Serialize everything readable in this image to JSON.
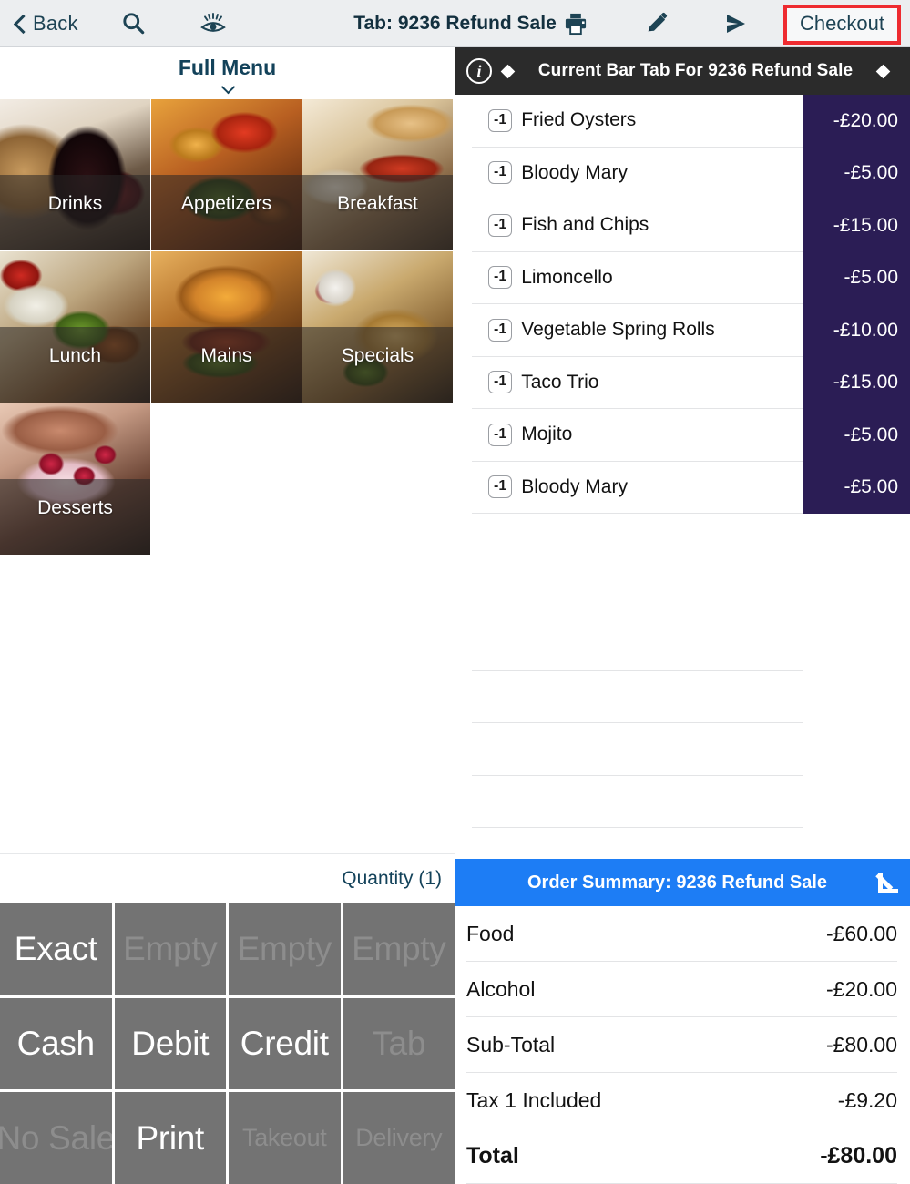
{
  "topbar": {
    "back_label": "Back",
    "title": "Tab: 9236 Refund Sale",
    "checkout_label": "Checkout",
    "icons": {
      "search": "search-icon",
      "eye": "eye-icon",
      "print": "printer-icon",
      "edit": "pencil-icon",
      "send": "send-icon"
    },
    "accent_red": "#ee2b30",
    "bg": "#eceef0",
    "text_color": "#1d4354"
  },
  "menu": {
    "header_title": "Full Menu",
    "categories": [
      {
        "label": "Drinks"
      },
      {
        "label": "Appetizers"
      },
      {
        "label": "Breakfast"
      },
      {
        "label": "Lunch"
      },
      {
        "label": "Mains"
      },
      {
        "label": "Specials"
      },
      {
        "label": "Desserts"
      }
    ]
  },
  "quantity_bar": {
    "label": "Quantity (1)"
  },
  "keypad": {
    "keys": [
      {
        "label": "Exact",
        "enabled": true
      },
      {
        "label": "Empty",
        "enabled": false
      },
      {
        "label": "Empty",
        "enabled": false
      },
      {
        "label": "Empty",
        "enabled": false
      },
      {
        "label": "Cash",
        "enabled": true
      },
      {
        "label": "Debit",
        "enabled": true
      },
      {
        "label": "Credit",
        "enabled": true
      },
      {
        "label": "Tab",
        "enabled": false
      },
      {
        "label": "No Sale",
        "enabled": false
      },
      {
        "label": "Print",
        "enabled": true
      },
      {
        "label": "Takeout",
        "enabled": false
      },
      {
        "label": "Delivery",
        "enabled": false
      }
    ],
    "button_bg": "#737373",
    "enabled_color": "#ffffff",
    "disabled_color": "#8d8d8d"
  },
  "order": {
    "header_title": "Current Bar Tab For 9236 Refund Sale",
    "header_bg": "#2b2b2b",
    "price_cell_bg": "#2b1d55",
    "items": [
      {
        "qty": "-1",
        "name": "Fried Oysters",
        "price": "-£20.00"
      },
      {
        "qty": "-1",
        "name": "Bloody Mary",
        "price": "-£5.00"
      },
      {
        "qty": "-1",
        "name": "Fish and Chips",
        "price": "-£15.00"
      },
      {
        "qty": "-1",
        "name": "Limoncello",
        "price": "-£5.00"
      },
      {
        "qty": "-1",
        "name": "Vegetable Spring Rolls",
        "price": "-£10.00"
      },
      {
        "qty": "-1",
        "name": "Taco Trio",
        "price": "-£15.00"
      },
      {
        "qty": "-1",
        "name": "Mojito",
        "price": "-£5.00"
      },
      {
        "qty": "-1",
        "name": "Bloody Mary",
        "price": "-£5.00"
      }
    ],
    "blank_row_count": 6
  },
  "summary": {
    "bar_title": "Order Summary: 9236 Refund Sale",
    "bar_bg": "#1d7df5",
    "rows": [
      {
        "label": "Food",
        "value": "-£60.00",
        "grand": false
      },
      {
        "label": "Alcohol",
        "value": "-£20.00",
        "grand": false
      },
      {
        "label": "Sub-Total",
        "value": "-£80.00",
        "grand": false
      },
      {
        "label": "Tax 1 Included",
        "value": "-£9.20",
        "grand": false
      },
      {
        "label": "Total",
        "value": "-£80.00",
        "grand": true
      }
    ]
  }
}
